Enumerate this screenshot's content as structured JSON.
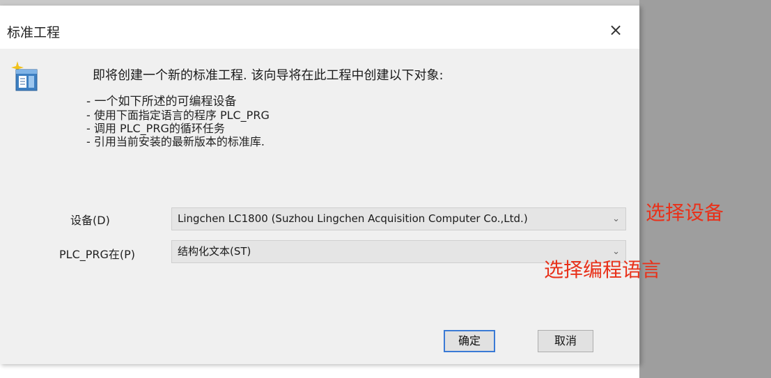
{
  "dialog": {
    "title": "标准工程",
    "close_symbol": "×"
  },
  "intro": "即将创建一个新的标准工程. 该向导将在此工程中创建以下对象:",
  "bullets": [
    "- 一个如下所述的可编程设备",
    "- 使用下面指定语言的程序 PLC_PRG",
    "- 调用 PLC_PRG的循环任务",
    "- 引用当前安装的最新版本的标准库."
  ],
  "form": {
    "device_label": "设备(D)",
    "device_value": "Lingchen LC1800 (Suzhou Lingchen Acquisition Computer Co.,Ltd.)",
    "language_label": "PLC_PRG在(P)",
    "language_value": "结构化文本(ST)"
  },
  "annotations": {
    "select_device": "选择设备",
    "select_language": "选择编程语言"
  },
  "buttons": {
    "ok": "确定",
    "cancel": "取消"
  },
  "icons": {
    "wizard": "wizard-sparkle-window-icon",
    "dropdown": "chevron-down-icon",
    "close": "close-icon"
  },
  "colors": {
    "annotation": "#e8311a",
    "focus_border": "#3a7ad5",
    "backdrop": "#9e9e9e"
  }
}
